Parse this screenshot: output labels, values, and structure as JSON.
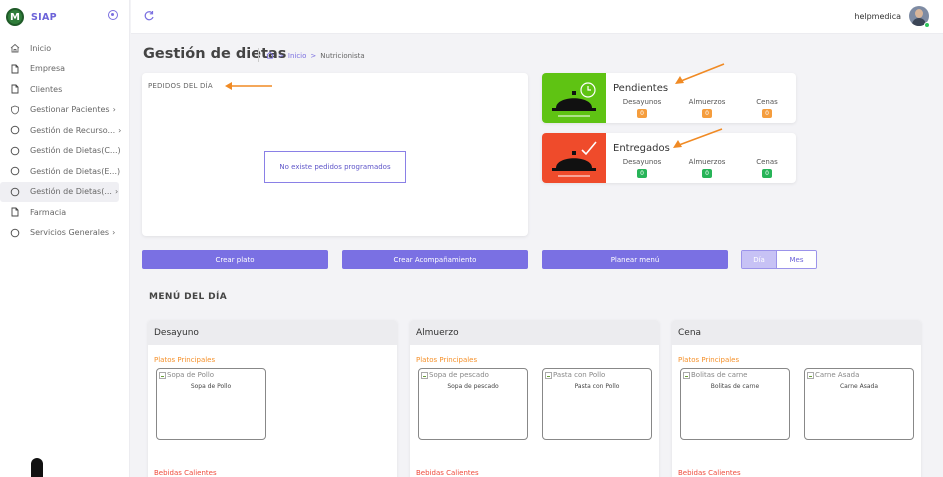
{
  "app": {
    "name": "SIAP",
    "logo_text": "M"
  },
  "user": {
    "name": "helpmedica"
  },
  "sidebar": {
    "items": [
      {
        "label": "Inicio",
        "icon": "home-icon",
        "arrow": ""
      },
      {
        "label": "Empresa",
        "icon": "file-icon",
        "arrow": ""
      },
      {
        "label": "Clientes",
        "icon": "file-icon",
        "arrow": ""
      },
      {
        "label": "Gestionar Pacientes",
        "icon": "shield-icon",
        "arrow": "›"
      },
      {
        "label": "Gestión de Recurso...",
        "icon": "circle-icon",
        "arrow": "›"
      },
      {
        "label": "Gestión de Dietas(C...)",
        "icon": "circle-icon",
        "arrow": ""
      },
      {
        "label": "Gestión de Dietas(E...)",
        "icon": "circle-icon",
        "arrow": ""
      },
      {
        "label": "Gestión de Dietas(...",
        "icon": "circle-icon",
        "arrow": "›"
      },
      {
        "label": "Farmacia",
        "icon": "file-icon",
        "arrow": ""
      },
      {
        "label": "Servicios Generales",
        "icon": "circle-icon",
        "arrow": "›"
      }
    ]
  },
  "header": {
    "title": "Gestión de dietas",
    "breadcrumb": {
      "sep1": ">",
      "item1": "Inicio",
      "sep2": ">",
      "item2": "Nutricionista"
    }
  },
  "pedidos": {
    "title": "PEDIDOS DEL DÍA",
    "empty_message": "No existe pedidos programados"
  },
  "status": {
    "pendientes": {
      "title": "Pendientes",
      "cols": [
        {
          "label": "Desayunos",
          "value": "0"
        },
        {
          "label": "Almuerzos",
          "value": "0"
        },
        {
          "label": "Cenas",
          "value": "0"
        }
      ]
    },
    "entregados": {
      "title": "Entregados",
      "cols": [
        {
          "label": "Desayunos",
          "value": "0"
        },
        {
          "label": "Almuerzos",
          "value": "0"
        },
        {
          "label": "Cenas",
          "value": "0"
        }
      ]
    }
  },
  "actions": {
    "crear_plato": "Crear plato",
    "crear_acomp": "Crear Acompañamiento",
    "planear_menu": "Planear menú",
    "toggle_dia": "Día",
    "toggle_mes": "Mes"
  },
  "menu": {
    "title": "MENÚ DEL DÍA",
    "meals": [
      {
        "name": "Desayuno",
        "section1": "Platos Principales",
        "section2": "Bebidas Calientes",
        "dishes": [
          {
            "img_alt": "Sopa de Pollo",
            "name": "Sopa de Pollo"
          }
        ]
      },
      {
        "name": "Almuerzo",
        "section1": "Platos Principales",
        "section2": "Bebidas Calientes",
        "dishes": [
          {
            "img_alt": "Sopa de pescado",
            "name": "Sopa de pescado"
          },
          {
            "img_alt": "Pasta con Pollo",
            "name": "Pasta con Pollo"
          }
        ]
      },
      {
        "name": "Cena",
        "section1": "Platos Principales",
        "section2": "Bebidas Calientes",
        "dishes": [
          {
            "img_alt": "Bolitas de carne",
            "name": "Bolitas de carne"
          },
          {
            "img_alt": "Carne Asada",
            "name": "Carne Asada"
          }
        ]
      }
    ]
  },
  "colors": {
    "accent": "#7a70e3",
    "pending_bg": "#5fc313",
    "delivered_bg": "#ef4b2b",
    "pending_badge": "#f59d3d",
    "delivered_badge": "#27b458",
    "arrow": "#f08a24"
  }
}
